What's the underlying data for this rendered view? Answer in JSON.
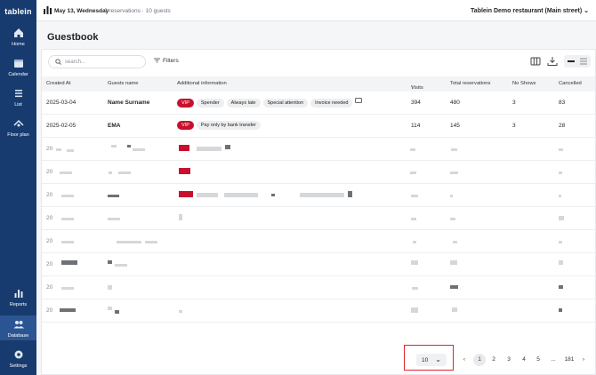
{
  "app": {
    "brand": "tablein"
  },
  "sidebar": {
    "items": [
      {
        "label": "Home",
        "icon": "home-icon"
      },
      {
        "label": "Calendar",
        "icon": "calendar-icon"
      },
      {
        "label": "List",
        "icon": "list-icon"
      },
      {
        "label": "Floor plan",
        "icon": "floor-plan-icon"
      },
      {
        "label": "Reports",
        "icon": "reports-icon"
      },
      {
        "label": "Database",
        "icon": "database-icon",
        "active": true
      },
      {
        "label": "Settings",
        "icon": "gear-icon"
      }
    ]
  },
  "topbar": {
    "date": "May 13, Wednesday",
    "meta": "2 reservations · 10 guests",
    "restaurant": "Tablein Demo restaurant (Main street)"
  },
  "page": {
    "title": "Guestbook"
  },
  "toolbar": {
    "search_placeholder": "search...",
    "filters_label": "Filters"
  },
  "table": {
    "columns": [
      "Created At",
      "Guests name",
      "Additional information",
      "Visits",
      "Total reservations",
      "No Shows",
      "Cancelled"
    ],
    "rows": [
      {
        "created": "2025-03-04",
        "name": "Name Surname",
        "tags": [
          "VIP",
          "Spender",
          "Always late",
          "Special attention",
          "Invoice needed"
        ],
        "visits": "394",
        "total": "480",
        "noshows": "3",
        "cancelled": "83"
      },
      {
        "created": "2025-02-05",
        "name": "EMA",
        "tags": [
          "VIP",
          "Pay only by bank transfer"
        ],
        "visits": "114",
        "total": "145",
        "noshows": "3",
        "cancelled": "28"
      },
      {
        "created": "20"
      },
      {
        "created": "20"
      },
      {
        "created": "20"
      },
      {
        "created": "20"
      },
      {
        "created": "20"
      },
      {
        "created": "20"
      },
      {
        "created": "20"
      },
      {
        "created": "20"
      }
    ]
  },
  "pagination": {
    "page_size": "10",
    "pages": [
      "1",
      "2",
      "3",
      "4",
      "5",
      "...",
      "181"
    ],
    "current": "1"
  },
  "colors": {
    "sidebar": "#173b6e",
    "vip": "#c8102e",
    "highlight": "#e0262f"
  }
}
